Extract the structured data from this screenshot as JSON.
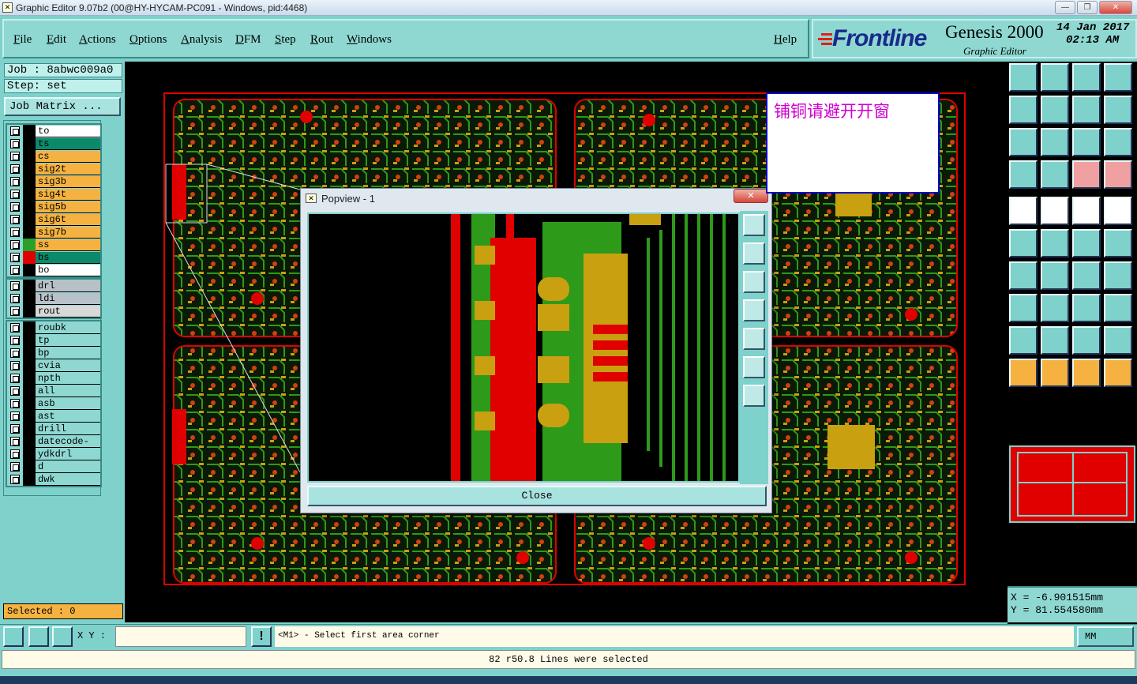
{
  "window": {
    "title": "Graphic Editor 9.07b2 (00@HY-HYCAM-PC091 - Windows, pid:4468)",
    "icon": "x-icon"
  },
  "menu": {
    "items": [
      "File",
      "Edit",
      "Actions",
      "Options",
      "Analysis",
      "DFM",
      "Step",
      "Rout",
      "Windows"
    ],
    "help": "Help"
  },
  "brand": {
    "logo": "Frontline",
    "product": "Genesis 2000",
    "subtitle": "Graphic Editor",
    "date": "14 Jan 2017",
    "time": "02:13 AM"
  },
  "job": {
    "job_label": "Job : 8abwc009a0",
    "step_label": "Step: set",
    "matrix_button": "Job Matrix ..."
  },
  "layers": {
    "group1": [
      {
        "name": "to",
        "color": "#ffffff",
        "swatch": "#000000"
      },
      {
        "name": "ts",
        "color": "#0a8a6a",
        "swatch": "#000000"
      },
      {
        "name": "cs",
        "color": "#f5b240",
        "swatch": "#000000"
      },
      {
        "name": "sig2t",
        "color": "#f5b240",
        "swatch": "#000000"
      },
      {
        "name": "sig3b",
        "color": "#f5b240",
        "swatch": "#000000"
      },
      {
        "name": "sig4t",
        "color": "#f5b240",
        "swatch": "#000000"
      },
      {
        "name": "sig5b",
        "color": "#f5b240",
        "swatch": "#000000"
      },
      {
        "name": "sig6t",
        "color": "#f5b240",
        "swatch": "#000000"
      },
      {
        "name": "sig7b",
        "color": "#f5b240",
        "swatch": "#000000"
      },
      {
        "name": "ss",
        "color": "#f5b240",
        "swatch": "#2aa02a"
      },
      {
        "name": "bs",
        "color": "#0a8a6a",
        "swatch": "#e00000"
      },
      {
        "name": "bo",
        "color": "#ffffff",
        "swatch": "#000000"
      }
    ],
    "group2": [
      {
        "name": "drl",
        "color": "#b8c0c8",
        "swatch": "#000000"
      },
      {
        "name": "ldi",
        "color": "#b8c0c8",
        "swatch": "#000000"
      },
      {
        "name": "rout",
        "color": "#d8d8d8",
        "swatch": "#000000"
      }
    ],
    "group3": [
      {
        "name": "roubk",
        "color": "#8fd8d2",
        "swatch": "#000000"
      },
      {
        "name": "tp",
        "color": "#8fd8d2",
        "swatch": "#000000"
      },
      {
        "name": "bp",
        "color": "#8fd8d2",
        "swatch": "#000000"
      },
      {
        "name": "cvia",
        "color": "#8fd8d2",
        "swatch": "#000000"
      },
      {
        "name": "npth",
        "color": "#8fd8d2",
        "swatch": "#000000"
      },
      {
        "name": "all",
        "color": "#8fd8d2",
        "swatch": "#000000"
      },
      {
        "name": "asb",
        "color": "#8fd8d2",
        "swatch": "#000000"
      },
      {
        "name": "ast",
        "color": "#8fd8d2",
        "swatch": "#000000"
      },
      {
        "name": "drill",
        "color": "#8fd8d2",
        "swatch": "#000000"
      },
      {
        "name": "datecode-pbc",
        "color": "#8fd8d2",
        "swatch": "#000000"
      },
      {
        "name": "ydkdrl",
        "color": "#8fd8d2",
        "swatch": "#000000"
      },
      {
        "name": "d",
        "color": "#8fd8d2",
        "swatch": "#000000"
      },
      {
        "name": "dwk",
        "color": "#8fd8d2",
        "swatch": "#000000"
      }
    ]
  },
  "selected": "Selected : 0",
  "popview": {
    "title": "Popview - 1",
    "close_label": "Close"
  },
  "note": "铺铜请避开开窗",
  "coords": {
    "x": "X  = -6.901515mm",
    "y": "Y  = 81.554580mm"
  },
  "command": {
    "xy_label": "X Y :",
    "xy_value": "",
    "prompt": "<M1> - Select first area corner",
    "units": "MM"
  },
  "status": "82 r50.8 Lines were selected",
  "colors": {
    "panel": "#7fd1cc",
    "copper": "#2d9a1a",
    "pad": "#c8a010",
    "mask": "#ff0000",
    "note_text": "#d000d0"
  }
}
